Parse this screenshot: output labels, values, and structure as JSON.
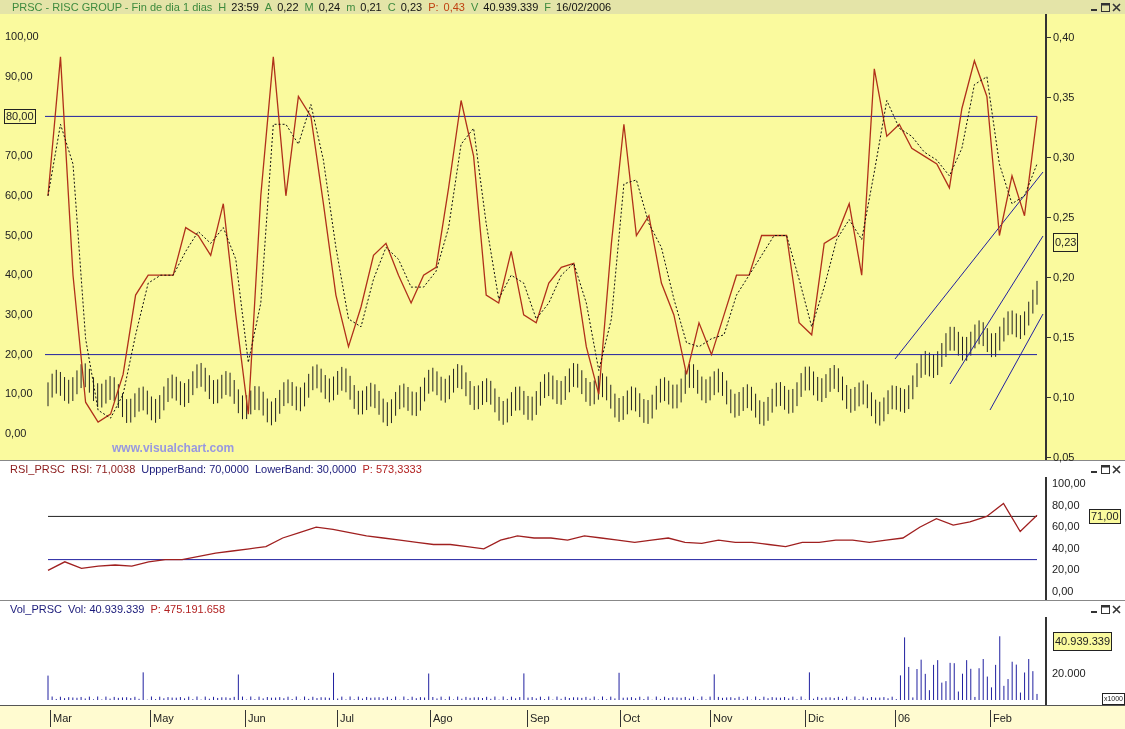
{
  "header": {
    "title": "PRSC - RISC GROUP - Fin de dia 1 dias",
    "fields": [
      {
        "label": "H",
        "value": "23:59",
        "kind": "plain"
      },
      {
        "label": "A",
        "value": "0,22",
        "kind": "plain"
      },
      {
        "label": "M",
        "value": "0,24",
        "kind": "plain"
      },
      {
        "label": "m",
        "value": "0,21",
        "kind": "plain"
      },
      {
        "label": "C",
        "value": "0,23",
        "kind": "plain"
      },
      {
        "label": "P:",
        "value": "0,43",
        "kind": "alert"
      },
      {
        "label": "V",
        "value": "40.939.339",
        "kind": "plain"
      },
      {
        "label": "F",
        "value": "16/02/2006",
        "kind": "plain"
      }
    ]
  },
  "price_panel": {
    "chart_data": {
      "type": "line",
      "ylim": [
        0,
        100
      ],
      "yticks": [
        {
          "value": 100,
          "label": "100,00"
        },
        {
          "value": 90,
          "label": "90,00"
        },
        {
          "value": 70,
          "label": "70,00"
        },
        {
          "value": 60,
          "label": "60,00"
        },
        {
          "value": 50,
          "label": "50,00"
        },
        {
          "value": 40,
          "label": "40,00"
        },
        {
          "value": 30,
          "label": "30,00"
        },
        {
          "value": 20,
          "label": "20,00"
        },
        {
          "value": 10,
          "label": "10,00"
        },
        {
          "value": 0,
          "label": "0,00"
        }
      ],
      "ref_lines": [
        {
          "axis": "y",
          "value": 80,
          "label": "80,00",
          "color": "#2020a0"
        },
        {
          "axis": "y",
          "value": 20,
          "color": "#2020a0"
        }
      ],
      "series": [
        {
          "color": "#b0301a",
          "values": [
            60,
            95,
            40,
            8,
            3,
            5,
            15,
            35,
            40,
            40,
            40,
            52,
            50,
            45,
            58,
            30,
            5,
            60,
            95,
            60,
            85,
            80,
            58,
            35,
            22,
            32,
            45,
            48,
            40,
            33,
            40,
            42,
            62,
            84,
            70,
            35,
            33,
            46,
            30,
            28,
            38,
            42,
            43,
            22,
            10,
            48,
            78,
            50,
            55,
            38,
            30,
            15,
            28,
            20,
            30,
            40,
            40,
            50,
            50,
            50,
            28,
            25,
            48,
            50,
            58,
            40,
            92,
            75,
            78,
            72,
            70,
            68,
            62,
            82,
            94,
            85,
            50,
            65,
            55,
            80
          ]
        },
        {
          "color": "#111111",
          "line_style": "dashed",
          "values": [
            60,
            78,
            68,
            24,
            6,
            4,
            10,
            25,
            38,
            40,
            40,
            46,
            51,
            48,
            52,
            44,
            18,
            33,
            78,
            78,
            73,
            83,
            69,
            47,
            29,
            27,
            39,
            47,
            44,
            37,
            37,
            41,
            52,
            73,
            77,
            53,
            34,
            40,
            38,
            29,
            33,
            40,
            43,
            33,
            16,
            29,
            63,
            64,
            53,
            47,
            34,
            23,
            22,
            24,
            25,
            35,
            40,
            45,
            50,
            50,
            39,
            27,
            37,
            49,
            54,
            49,
            66,
            84,
            77,
            75,
            71,
            69,
            65,
            72,
            88,
            90,
            68,
            58,
            60,
            68
          ]
        }
      ]
    },
    "right_axis": [
      "0,40",
      "0,35",
      "0,30",
      "0,25",
      "0,20",
      "0,15",
      "0,10",
      "0,05"
    ],
    "price_marker": "0,23",
    "branding": "www.visualchart.com"
  },
  "rsi_panel": {
    "legend": [
      {
        "text": "RSI_PRSC",
        "color": "#8b1a1a"
      },
      {
        "text": "RSI: 71,0038",
        "color": "#8b1a1a"
      },
      {
        "text": "UppperBand: 70,0000",
        "color": "#1a1a7a"
      },
      {
        "text": "LowerBand: 30,0000",
        "color": "#1a1a7a"
      },
      {
        "text": "P: 573,3333",
        "color": "#b22222"
      }
    ],
    "chart_data": {
      "type": "line",
      "ylim": [
        -7.4,
        106.5
      ],
      "yticks": [
        {
          "value": 100,
          "label": "100,00"
        },
        {
          "value": 80,
          "label": "80,00"
        },
        {
          "value": 60,
          "label": "60,00"
        },
        {
          "value": 40,
          "label": "40,00"
        },
        {
          "value": 20,
          "label": "20,00"
        },
        {
          "value": 0,
          "label": "0,00"
        }
      ],
      "ref_lines": [
        {
          "axis": "y",
          "value": 70,
          "color": "#222222"
        },
        {
          "axis": "y",
          "value": 30,
          "color": "#2020a0"
        }
      ],
      "series": [
        {
          "color": "#a02020",
          "values": [
            20,
            28,
            22,
            24,
            25,
            24,
            28,
            30,
            30,
            33,
            36,
            38,
            40,
            42,
            50,
            55,
            60,
            58,
            55,
            52,
            50,
            48,
            46,
            44,
            44,
            42,
            40,
            48,
            52,
            50,
            50,
            48,
            52,
            50,
            48,
            46,
            48,
            50,
            46,
            45,
            48,
            46,
            46,
            44,
            42,
            46,
            46,
            48,
            48,
            46,
            48,
            50,
            60,
            68,
            62,
            65,
            70,
            82,
            56,
            71
          ]
        }
      ]
    },
    "value_marker": "71,00"
  },
  "volume_panel": {
    "legend": [
      {
        "text": "Vol_PRSC",
        "color": "#1a1a7a"
      },
      {
        "text": "Vol: 40.939.339",
        "color": "#1a1a7a"
      },
      {
        "text": "P: 475.191.658",
        "color": "#b22222"
      }
    ],
    "right_axis": [
      "20.000"
    ],
    "value_marker": "40.939.339",
    "scale_note": "x1000"
  },
  "x_axis": [
    "Mar",
    "May",
    "Jun",
    "Jul",
    "Ago",
    "Sep",
    "Oct",
    "Nov",
    "Dic",
    "06",
    "Feb"
  ]
}
